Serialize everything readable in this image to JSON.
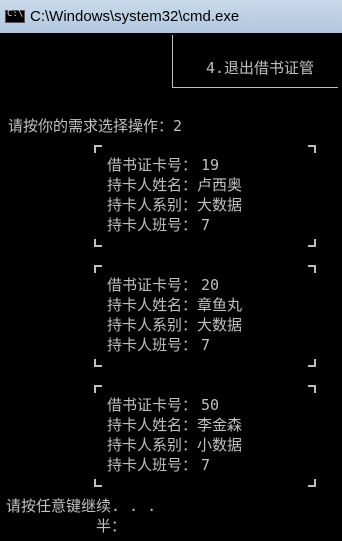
{
  "window": {
    "title": "C:\\Windows\\system32\\cmd.exe"
  },
  "console": {
    "menu_item": "4.退出借书证管",
    "prompt": "请按你的需求选择操作：",
    "choice": "2",
    "records": [
      {
        "card_label": "借书证卡号：",
        "card": "19",
        "name_label": "持卡人姓名：",
        "name": "卢西奥",
        "dept_label": "持卡人系别：",
        "dept": "大数据",
        "class_label": "持卡人班号：",
        "class": "7"
      },
      {
        "card_label": "借书证卡号：",
        "card": "20",
        "name_label": "持卡人姓名：",
        "name": "章鱼丸",
        "dept_label": "持卡人系别：",
        "dept": "大数据",
        "class_label": "持卡人班号：",
        "class": "7"
      },
      {
        "card_label": "借书证卡号：",
        "card": "50",
        "name_label": "持卡人姓名：",
        "name": "李金森",
        "dept_label": "持卡人系别：",
        "dept": "小数据",
        "class_label": "持卡人班号：",
        "class": "7"
      }
    ],
    "continue": "请按任意键继续. . .",
    "ime": "半："
  }
}
